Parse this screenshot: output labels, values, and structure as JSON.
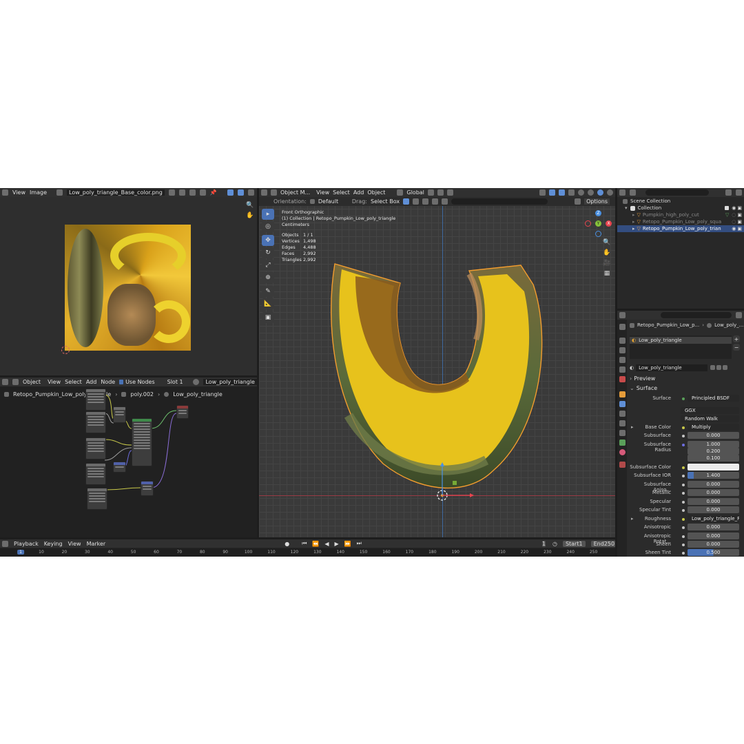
{
  "image_editor": {
    "menu_view": "View",
    "menu_image": "Image",
    "image_name": "Low_poly_triangle_Base_color.png"
  },
  "node_editor": {
    "object_mode": "Object",
    "menu_view": "View",
    "menu_select": "Select",
    "menu_add": "Add",
    "menu_node": "Node",
    "use_nodes_label": "Use Nodes",
    "slot": "Slot 1",
    "material_name": "Low_poly_triangle",
    "breadcrumb": [
      "Retopo_Pumpkin_Low_poly_triangle",
      "poly.002",
      "Low_poly_triangle"
    ]
  },
  "viewport": {
    "mode": "Object M...",
    "menu": [
      "View",
      "Select",
      "Add",
      "Object"
    ],
    "transform_orientation": "Global",
    "orientation_label": "Orientation:",
    "orientation_value": "Default",
    "drag_label": "Drag:",
    "drag_value": "Select Box",
    "options_label": "Options",
    "view_name": "Front Orthographic",
    "collection_path": "(1) Collection | Retopo_Pumpkin_Low_poly_triangle",
    "units": "Centimeters",
    "stats": [
      {
        "key": "Objects",
        "value": "1 / 1"
      },
      {
        "key": "Vertices",
        "value": "1,498"
      },
      {
        "key": "Edges",
        "value": "4,488"
      },
      {
        "key": "Faces",
        "value": "2,992"
      },
      {
        "key": "Triangles",
        "value": "2,992"
      }
    ],
    "gizmo": {
      "z": "Z",
      "y": "Y",
      "x": "X"
    },
    "accent_red": "#e8444f",
    "accent_green": "#86c23a",
    "accent_blue": "#4a90e2"
  },
  "outliner": {
    "scene_collection": "Scene Collection",
    "collection": "Collection",
    "items": [
      {
        "name": "Pumpkin_high_poly_cut",
        "selected": false
      },
      {
        "name": "Retopo_Pumpkin_Low_poly_squa",
        "selected": false
      },
      {
        "name": "Retopo_Pumpkin_Low_poly_trian",
        "selected": true
      }
    ]
  },
  "properties": {
    "breadcrumb_object": "Retopo_Pumpkin_Low_p...",
    "breadcrumb_material": "Low_poly_...",
    "slot_item": "Low_poly_triangle",
    "material_field": "Low_poly_triangle",
    "preview_label": "Preview",
    "surface_label": "Surface",
    "surface_shader": "Principled BSDF",
    "distribution": "GGX",
    "subsurface_method": "Random Walk",
    "rows": [
      {
        "label": "Base Color",
        "value": "Multiply",
        "kind": "link",
        "arrow": true
      },
      {
        "label": "Subsurface",
        "value": "0.000",
        "kind": "num"
      },
      {
        "label": "Subsurface Radius",
        "value": "1.000",
        "kind": "num"
      },
      {
        "label": "",
        "value": "0.200",
        "kind": "num"
      },
      {
        "label": "",
        "value": "0.100",
        "kind": "num"
      },
      {
        "label": "Subsurface Color",
        "value": "",
        "kind": "color"
      },
      {
        "label": "Subsurface IOR",
        "value": "1.400",
        "kind": "num"
      },
      {
        "label": "Subsurface Aniso...",
        "value": "0.000",
        "kind": "num"
      },
      {
        "label": "Metallic",
        "value": "0.000",
        "kind": "num"
      },
      {
        "label": "Specular",
        "value": "0.000",
        "kind": "num"
      },
      {
        "label": "Specular Tint",
        "value": "0.000",
        "kind": "num"
      },
      {
        "label": "Roughness",
        "value": "Low_poly_triangle_R...",
        "kind": "link",
        "arrow": true
      },
      {
        "label": "Anisotropic",
        "value": "0.000",
        "kind": "num"
      },
      {
        "label": "Anisotropic Rotat...",
        "value": "0.000",
        "kind": "num"
      },
      {
        "label": "Sheen",
        "value": "0.000",
        "kind": "num"
      },
      {
        "label": "Sheen Tint",
        "value": "0.500",
        "kind": "slider"
      }
    ]
  },
  "timeline": {
    "menu": [
      "Playback",
      "Keying",
      "View",
      "Marker"
    ],
    "current_frame": "1",
    "start_label": "Start",
    "start_value": "1",
    "end_label": "End",
    "end_value": "250",
    "ticks": [
      "1",
      "10",
      "20",
      "30",
      "40",
      "50",
      "60",
      "70",
      "80",
      "90",
      "100",
      "110",
      "120",
      "130",
      "140",
      "150",
      "160",
      "170",
      "180",
      "190",
      "200",
      "210",
      "220",
      "230",
      "240",
      "250"
    ]
  }
}
